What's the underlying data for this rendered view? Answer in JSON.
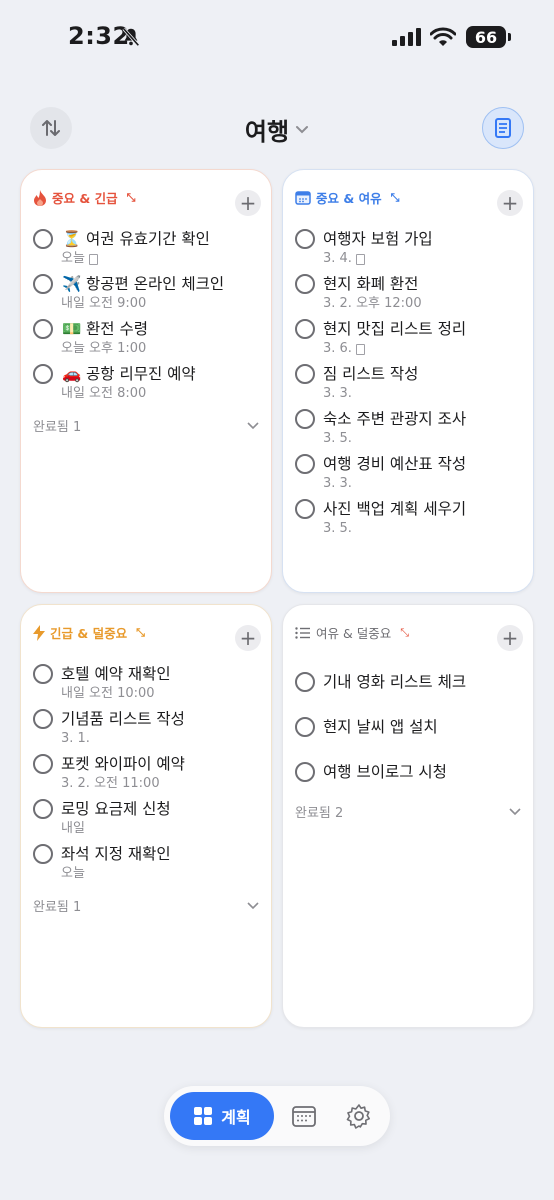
{
  "status": {
    "time": "2:32",
    "battery": "66"
  },
  "header": {
    "title": "여행"
  },
  "quadrants": [
    {
      "label": "중요 & 긴급",
      "color": "#e5533d",
      "items": [
        {
          "emoji": "⏳",
          "title": "여권 유효기간 확인",
          "sub": "오늘",
          "has_note": true
        },
        {
          "emoji": "✈️",
          "title": "항공편 온라인 체크인",
          "sub": "내일 오전 9:00",
          "has_note": false
        },
        {
          "emoji": "💵",
          "title": "환전 수령",
          "sub": "오늘 오후 1:00",
          "has_note": false
        },
        {
          "emoji": "🚗",
          "title": "공항 리무진 예약",
          "sub": "내일 오전 8:00",
          "has_note": false
        }
      ],
      "done_label": "완료됨 1"
    },
    {
      "label": "중요 & 여유",
      "color": "#3d7ee8",
      "items": [
        {
          "title": "여행자 보험 가입",
          "sub": "3. 4.",
          "has_note": true
        },
        {
          "title": "현지 화폐 환전",
          "sub": "3. 2. 오후 12:00",
          "has_note": false
        },
        {
          "title": "현지 맛집 리스트 정리",
          "sub": "3. 6.",
          "has_note": true
        },
        {
          "title": "짐 리스트 작성",
          "sub": "3. 3.",
          "has_note": false
        },
        {
          "title": "숙소 주변 관광지 조사",
          "sub": "3. 5.",
          "has_note": false
        },
        {
          "title": "여행 경비 예산표 작성",
          "sub": "3. 3.",
          "has_note": false
        },
        {
          "title": "사진 백업 계획 세우기",
          "sub": "3. 5.",
          "has_note": false
        }
      ]
    },
    {
      "label": "긴급 & 덜중요",
      "color": "#e89a2c",
      "items": [
        {
          "title": "호텔 예약 재확인",
          "sub": "내일 오전 10:00",
          "has_note": false
        },
        {
          "title": "기념품 리스트 작성",
          "sub": "3. 1.",
          "has_note": false
        },
        {
          "title": "포켓 와이파이 예약",
          "sub": "3. 2. 오전 11:00",
          "has_note": false
        },
        {
          "title": "로밍 요금제 신청",
          "sub": "내일",
          "has_note": false
        },
        {
          "title": "좌석 지정 재확인",
          "sub": "오늘",
          "has_note": false
        }
      ],
      "done_label": "완료됨 1"
    },
    {
      "label": "여유 & 덜중요",
      "color": "#6e6e73",
      "items": [
        {
          "title": "기내 영화 리스트 체크"
        },
        {
          "title": "현지 날씨 앱 설치"
        },
        {
          "title": "여행 브이로그 시청"
        }
      ],
      "done_label": "완료됨 2"
    }
  ],
  "bottom_nav": {
    "plan_label": "계획"
  },
  "icons": [
    "bell-slash-icon",
    "signal-icon",
    "wifi-icon",
    "battery-icon",
    "sort-icon",
    "chevron-down-icon",
    "note-icon",
    "fire-icon",
    "calendar-icon",
    "bolt-icon",
    "list-icon",
    "expand-icon",
    "plus-icon",
    "grid-icon",
    "settings-icon"
  ]
}
